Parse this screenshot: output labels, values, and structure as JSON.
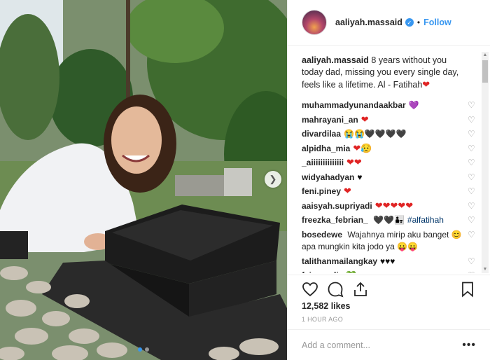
{
  "post": {
    "username": "aaliyah.massaid",
    "follow_label": "Follow",
    "separator": "•",
    "caption_user": "aaliyah.massaid",
    "caption_text": "8 years without you today dad, missing you every single day, feels like a lifetime. Al - Fatihah",
    "likes": "12,582 likes",
    "time": "1 HOUR AGO",
    "comment_placeholder": "Add a comment...",
    "more_label": "•••"
  },
  "comments": [
    {
      "user": "muhammadyunandaakbar",
      "text": "",
      "emoji": "💜",
      "emoji_class": "purple"
    },
    {
      "user": "mahrayani_an",
      "text": "",
      "emoji": "❤",
      "emoji_class": "heart-emoji"
    },
    {
      "user": "divardilaa",
      "text": "",
      "emoji": "😭😭🖤🖤🖤🖤",
      "emoji_class": "blackheart"
    },
    {
      "user": "alpidha_mia",
      "text": "",
      "emoji": "❤😥",
      "emoji_class": "heart-emoji"
    },
    {
      "user": "_aiiiiiiiiiiiiii",
      "text": "",
      "emoji": "❤❤",
      "emoji_class": "heart-emoji"
    },
    {
      "user": "widyahadyan",
      "text": "",
      "emoji": "♥",
      "emoji_class": "blackheart"
    },
    {
      "user": "feni.piney",
      "text": "",
      "emoji": "❤",
      "emoji_class": "heart-emoji"
    },
    {
      "user": "aaisyah.supriyadi",
      "text": "",
      "emoji": "❤❤❤❤❤",
      "emoji_class": "heart-emoji"
    },
    {
      "user": "freezka_febrian_",
      "text": "🖤🖤👨‍👧",
      "emoji": "#alfatihah",
      "emoji_class": "hashtag"
    },
    {
      "user": "bosedewe",
      "text": "Wajahnya mirip aku banget 😊 apa mungkin kita jodo ya 😛😛",
      "emoji": "",
      "emoji_class": ""
    },
    {
      "user": "talithanmailangkay",
      "text": "",
      "emoji": "♥♥♥",
      "emoji_class": "blackheart"
    },
    {
      "user": "fajar_yulia",
      "text": "",
      "emoji": "💚",
      "emoji_class": "green"
    }
  ],
  "icons": {
    "like": "heart-outline-icon",
    "comment": "speech-bubble-icon",
    "share": "share-icon",
    "save": "bookmark-icon"
  },
  "colors": {
    "accent": "#3897f0",
    "heart": "#e02424"
  }
}
